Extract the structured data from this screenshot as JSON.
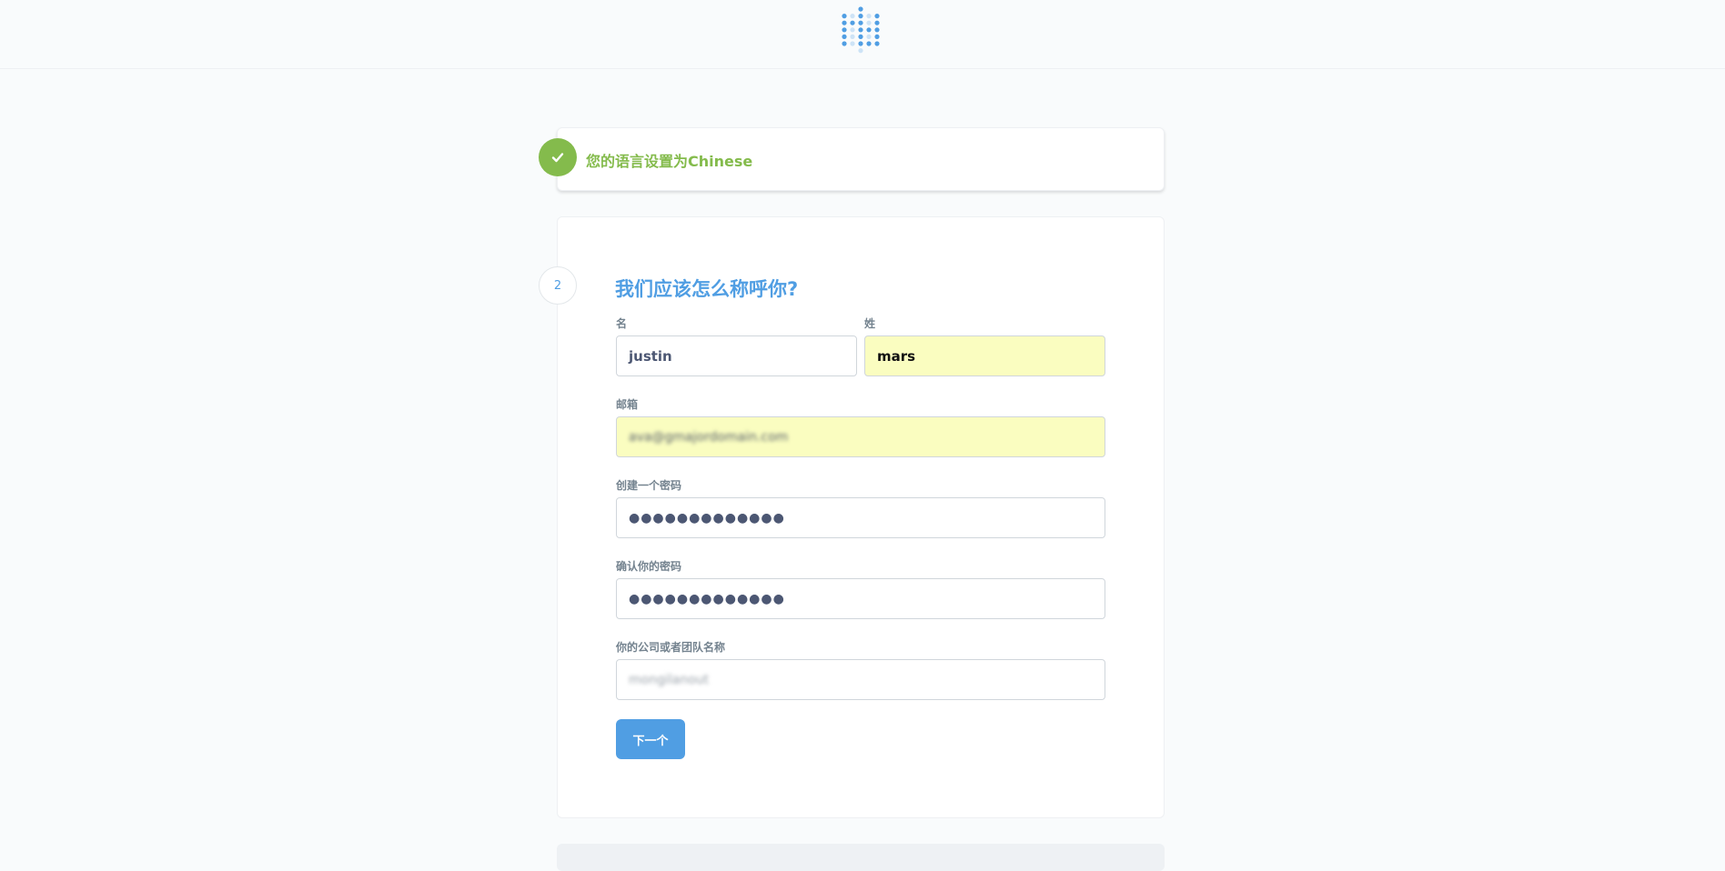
{
  "language_step": {
    "status_text": "您的语言设置为Chinese"
  },
  "user_step": {
    "step_number": "2",
    "heading": "我们应该怎么称呼你?",
    "fields": {
      "first_name": {
        "label": "名",
        "value": "justin"
      },
      "last_name": {
        "label": "姓",
        "value": "mars"
      },
      "email": {
        "label": "邮箱",
        "value": "ava@gmajordomain.com"
      },
      "password": {
        "label": "创建一个密码",
        "value": "●●●●●●●●●●●●●"
      },
      "confirm_password": {
        "label": "确认你的密码",
        "value": "●●●●●●●●●●●●●"
      },
      "company": {
        "label": "你的公司或者团队名称",
        "value": "mongilanout"
      }
    },
    "next_button_label": "下一个"
  },
  "colors": {
    "accent_blue": "#509ee3",
    "success_green": "#84bb4c",
    "autofill_yellow": "#fafdc0"
  },
  "icons": {
    "logo": "metabase-dots-logo",
    "done": "check-icon"
  }
}
